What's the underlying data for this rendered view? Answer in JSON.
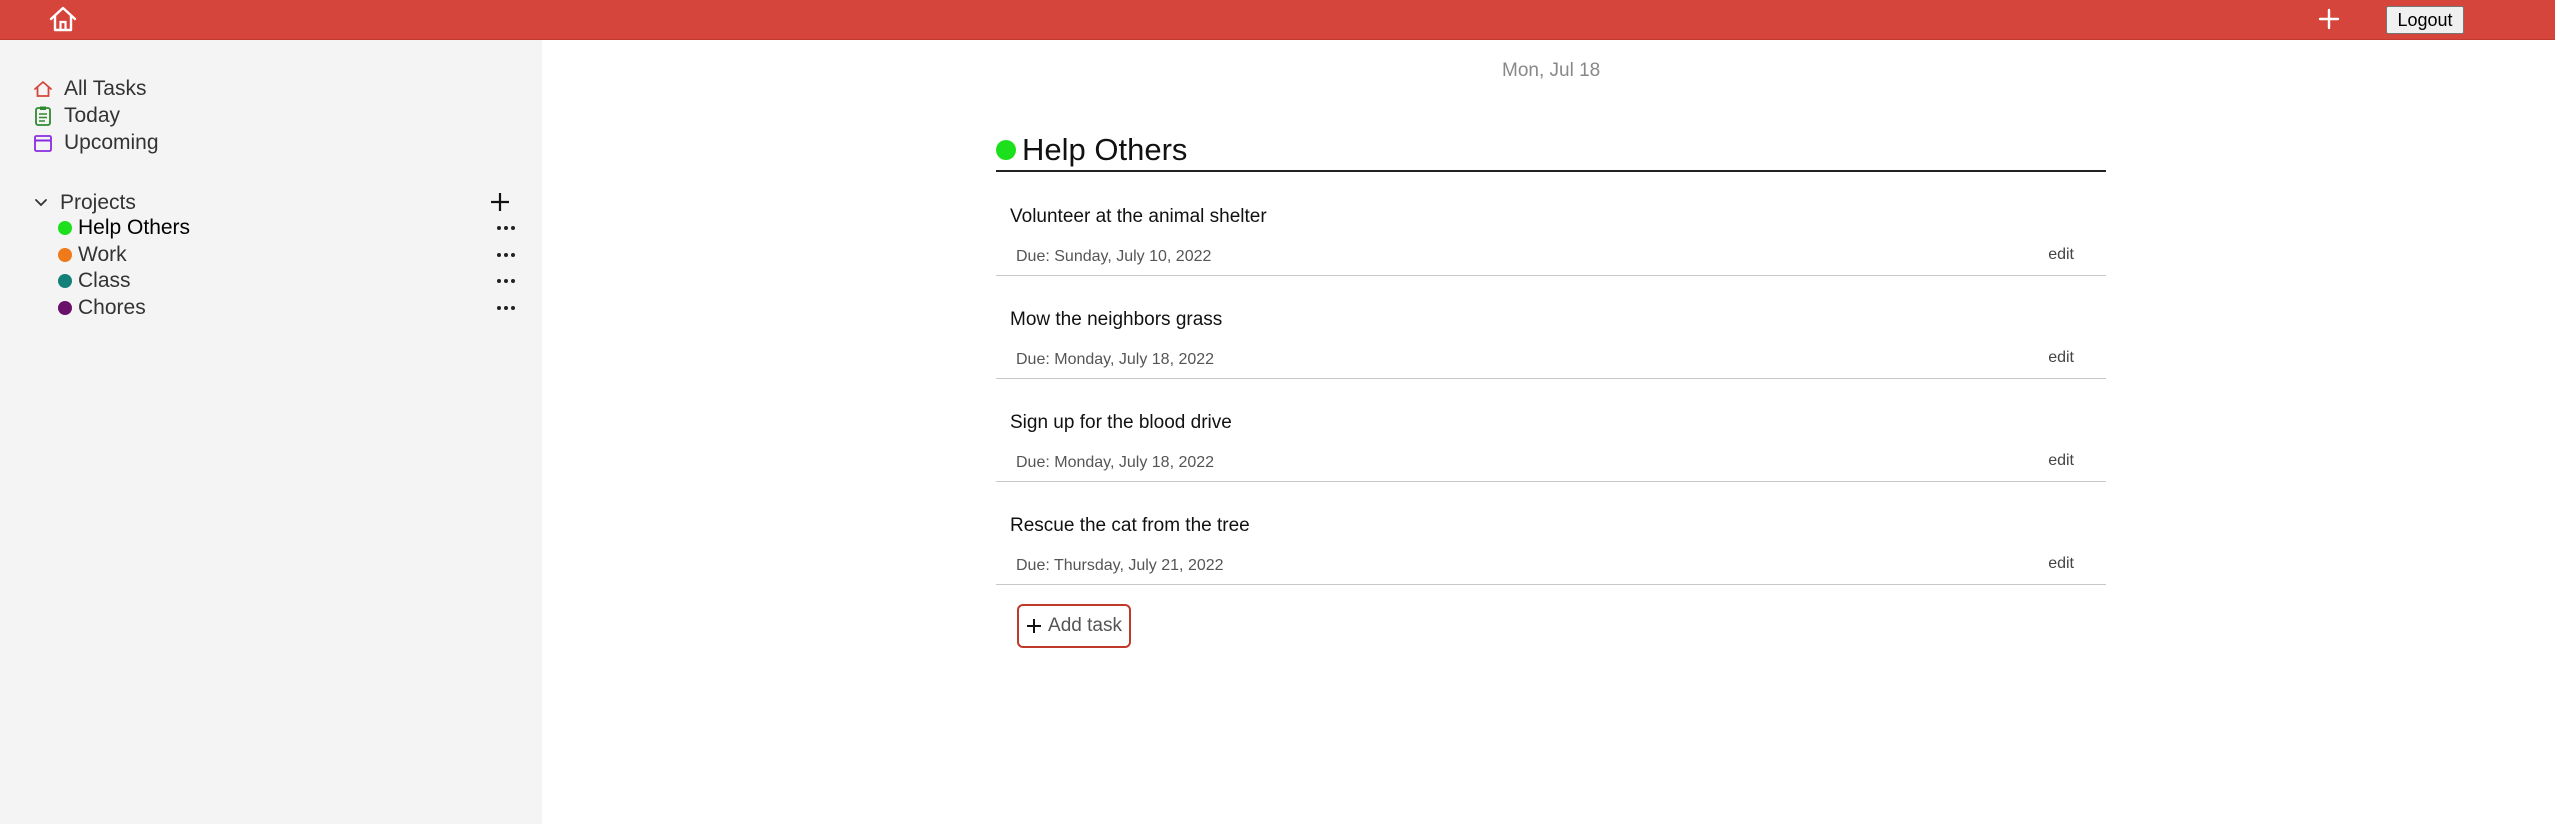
{
  "header": {
    "home_icon": "home-icon",
    "add_icon": "plus-icon",
    "logout_label": "Logout"
  },
  "sidebar": {
    "nav": [
      {
        "label": "All Tasks",
        "icon": "home-icon"
      },
      {
        "label": "Today",
        "icon": "clipboard-icon"
      },
      {
        "label": "Upcoming",
        "icon": "calendar-icon"
      }
    ],
    "projects_label": "Projects",
    "projects": [
      {
        "name": "Help Others",
        "color": "#1de01d",
        "active": true
      },
      {
        "name": "Work",
        "color": "#f07a1a",
        "active": false
      },
      {
        "name": "Class",
        "color": "#14807a",
        "active": false
      },
      {
        "name": "Chores",
        "color": "#6a0f6a",
        "active": false
      }
    ]
  },
  "main": {
    "date": "Mon, Jul 18",
    "project_title": "Help Others",
    "project_color": "#1de01d",
    "tasks": [
      {
        "name": "Volunteer at the animal shelter",
        "due": "Due: Sunday, July 10, 2022",
        "edit": "edit"
      },
      {
        "name": "Mow the neighbors grass",
        "due": "Due: Monday, July 18, 2022",
        "edit": "edit"
      },
      {
        "name": "Sign up for the blood drive",
        "due": "Due: Monday, July 18, 2022",
        "edit": "edit"
      },
      {
        "name": "Rescue the cat from the tree",
        "due": "Due: Thursday, July 21, 2022",
        "edit": "edit"
      }
    ],
    "add_task_label": "Add task"
  },
  "colors": {
    "accent": "#d6453b",
    "sidebar_bg": "#f4f4f4"
  }
}
